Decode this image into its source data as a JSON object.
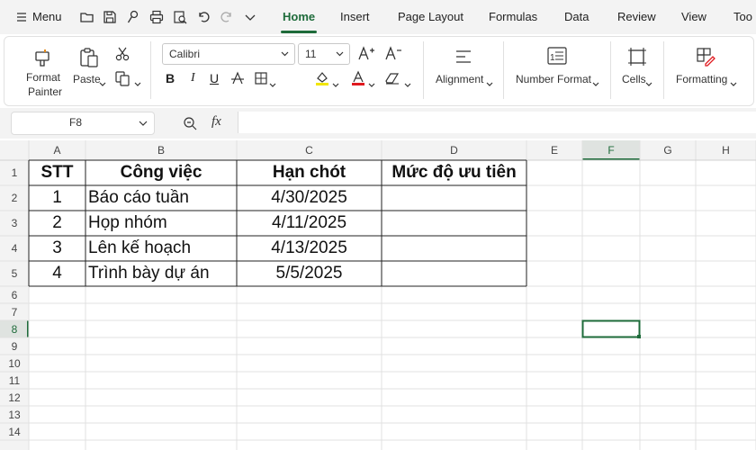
{
  "topbar": {
    "menu_label": "Menu",
    "tabs": [
      {
        "label": "Home",
        "active": true
      },
      {
        "label": "Insert"
      },
      {
        "label": "Page Layout"
      },
      {
        "label": "Formulas"
      },
      {
        "label": "Data"
      },
      {
        "label": "Review"
      },
      {
        "label": "View"
      },
      {
        "label": "Too"
      }
    ]
  },
  "ribbon": {
    "format_painter_line1": "Format",
    "format_painter_line2": "Painter",
    "paste_label": "Paste",
    "font_name": "Calibri",
    "font_size": "11",
    "alignment_label": "Alignment",
    "number_format_label": "Number Format",
    "cells_label": "Cells",
    "formatting_label": "Formatting",
    "colors": {
      "highlight": "#f2e600",
      "font_color": "#e0191f",
      "accent": "#1e6b3a"
    }
  },
  "formula_bar": {
    "name_box": "F8",
    "fx_label": "fx",
    "formula_value": ""
  },
  "sheet": {
    "columns": [
      "A",
      "B",
      "C",
      "D",
      "E",
      "F",
      "G",
      "H"
    ],
    "rows": [
      "1",
      "2",
      "3",
      "4",
      "5",
      "6",
      "7",
      "8",
      "9",
      "10",
      "11",
      "12",
      "13",
      "14"
    ],
    "active_column": "F",
    "active_row": "8",
    "headers": [
      "STT",
      "Công việc",
      "Hạn chót",
      "Mức độ ưu tiên"
    ],
    "data": [
      [
        "1",
        "Báo cáo tuần",
        "4/30/2025",
        ""
      ],
      [
        "2",
        "Họp nhóm",
        "4/11/2025",
        ""
      ],
      [
        "3",
        "Lên kế hoạch",
        "4/13/2025",
        ""
      ],
      [
        "4",
        "Trình bày dự án",
        "5/5/2025",
        ""
      ]
    ]
  }
}
